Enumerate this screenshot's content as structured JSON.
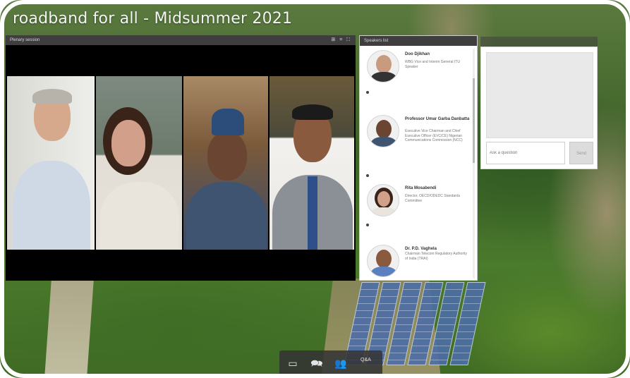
{
  "banner": {
    "title": "roadband for all - Midsummer 2021"
  },
  "video": {
    "header_label": "Plenary session",
    "controls": "⊞ ⌗ ⛶"
  },
  "speakers_panel": {
    "header_label": "Speakers list",
    "speakers": [
      {
        "name": "Doo Djikhan",
        "role": "WBG Vice and Interim General ITU Speaker"
      },
      {
        "name": "Professor Umar Garba Danbatta",
        "role": "Executive Vice Chairman and Chief Executive Officer (EVC/CE) Nigerian Communications Commission (NCC)"
      },
      {
        "name": "Rita Mosabendi",
        "role": "Director, OECD/ODEDC Standards Committee"
      },
      {
        "name": "Dr. P.D. Vaghela",
        "role": "Chairman Telecom Regulatory Authority of India (TRAI)"
      }
    ]
  },
  "chat": {
    "header_label": "",
    "input_placeholder": "Ask a question",
    "send_label": "Send"
  },
  "toolbar": {
    "screen_icon": "▭",
    "chat_icon": "🗪",
    "people_icon": "👥",
    "label": "Q&A"
  },
  "colors": {
    "panel_header": "#3e3e3e",
    "video_bg": "#000000",
    "toolbar_bg": "#343434"
  }
}
